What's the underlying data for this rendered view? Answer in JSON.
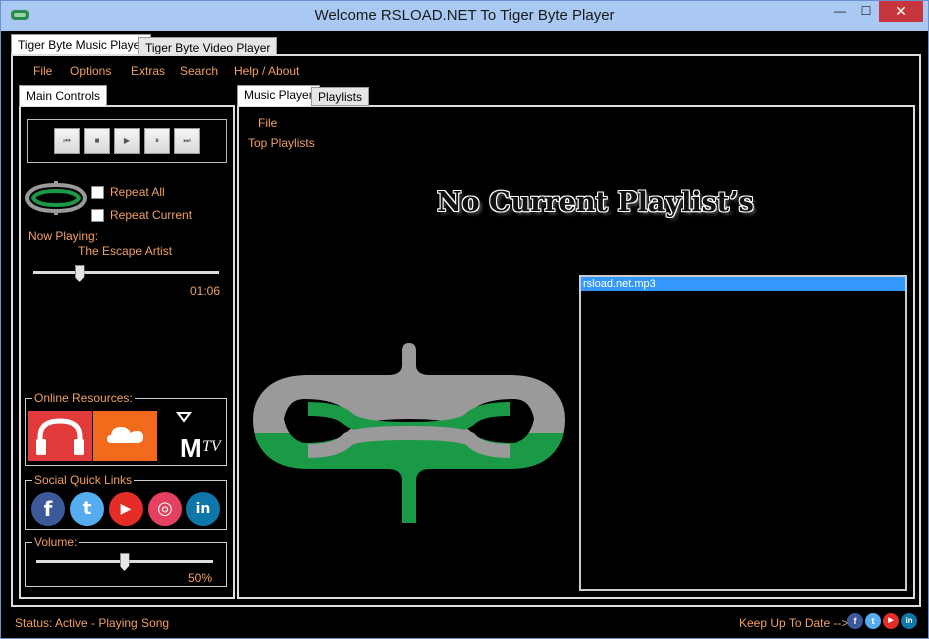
{
  "window": {
    "title": "Welcome RSLOAD.NET To Tiger Byte Player",
    "minimize_glyph": "—",
    "maximize_glyph": "☐",
    "close_glyph": "✕"
  },
  "outer_tabs": [
    "Tiger Byte Music Player",
    "Tiger Byte Video Player"
  ],
  "menu": [
    "File",
    "Options",
    "Extras",
    "Search",
    "Help / About"
  ],
  "left": {
    "tab": "Main Controls",
    "transport_icons": [
      "previous-icon",
      "stop-icon",
      "play-icon",
      "pause-icon",
      "next-icon"
    ],
    "transport_glyphs": [
      "⏮",
      "■",
      "▶",
      "⏸",
      "⏭"
    ],
    "repeat_all": "Repeat All",
    "repeat_current": "Repeat Current",
    "now_playing_label": "Now Playing:",
    "song": "The Escape Artist",
    "elapsed": "01:06",
    "seek_fraction": 0.25,
    "online_resources_label": "Online Resources:",
    "online_resources": [
      "headphones-icon",
      "soundcloud-icon",
      "mtv-icon"
    ],
    "social_label": "Social Quick Links",
    "social": [
      {
        "icon": "facebook-icon",
        "glyph": "f",
        "color": "#3b5998"
      },
      {
        "icon": "twitter-icon",
        "glyph": "t",
        "color": "#55acee"
      },
      {
        "icon": "youtube-icon",
        "glyph": "▶",
        "color": "#e52d27"
      },
      {
        "icon": "instagram-icon",
        "glyph": "◎",
        "color": "#e4405f"
      },
      {
        "icon": "linkedin-icon",
        "glyph": "in",
        "color": "#0e76a8"
      }
    ],
    "volume_label": "Volume:",
    "volume": "50%",
    "volume_fraction": 0.5
  },
  "right": {
    "tabs": [
      "Music Player",
      "Playlists"
    ],
    "file_menu": "File",
    "top_playlists": "Top Playlists",
    "no_playlist": "No Current Playlist’s",
    "playlist_items": [
      "rsload.net.mp3"
    ]
  },
  "status": {
    "text": "Status: Active - Playing Song",
    "keep_up": "Keep Up To Date -->"
  },
  "colors": {
    "accent_text": "#f0a060",
    "logo_green": "#1a9a46",
    "logo_gray": "#9a9a9a",
    "selection": "#3399ff"
  }
}
